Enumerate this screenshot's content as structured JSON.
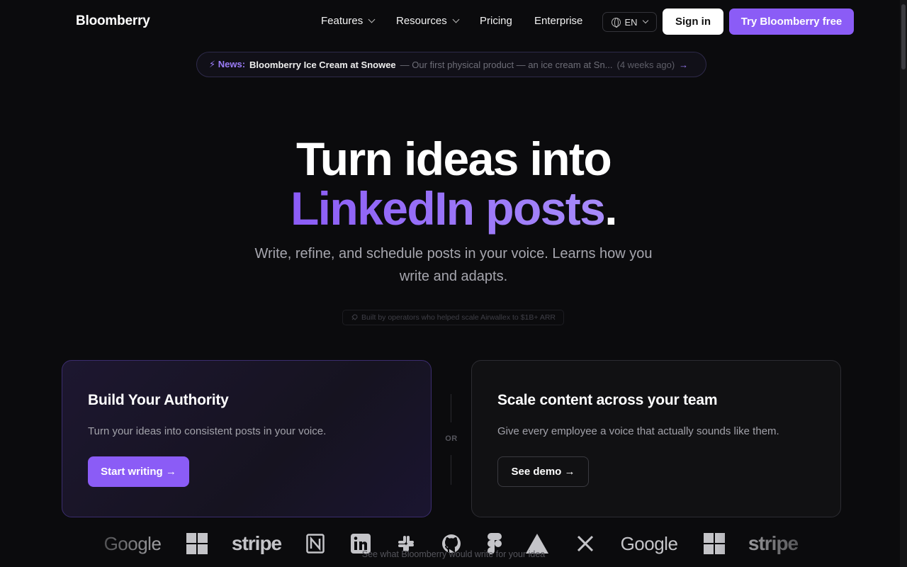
{
  "nav": {
    "logo": "Bloomberry",
    "features": "Features",
    "resources": "Resources",
    "pricing": "Pricing",
    "enterprise": "Enterprise",
    "language": "EN",
    "sign_in": "Sign in",
    "try_free": "Try Bloomberry free"
  },
  "news": {
    "tag": "⚡ News:",
    "title": "Bloomberry Ice Cream at Snowee",
    "description": "— Our first physical product — an ice cream at Sn...",
    "time": "(4 weeks ago)",
    "arrow": "→"
  },
  "hero": {
    "line1": "Turn ideas into",
    "highlight": "LinkedIn posts",
    "period": ".",
    "subtitle": "Write, refine, and schedule posts in your voice. Learns how you write and adapts.",
    "built_by": "Built by operators who helped scale Airwallex to $1B+ ARR"
  },
  "cards": {
    "authority": {
      "title": "Build Your Authority",
      "description": "Turn your ideas into consistent posts in your voice.",
      "button": "Start writing →"
    },
    "or": "OR",
    "team": {
      "title": "Scale content across your team",
      "description": "Give every employee a voice that actually sounds like them.",
      "button": "See demo →"
    }
  },
  "logos": {
    "google": "Google",
    "stripe": "stripe",
    "notion": "N",
    "linkedin": "in",
    "items": [
      "google",
      "microsoft",
      "stripe",
      "notion",
      "linkedin",
      "slack",
      "github",
      "figma",
      "vercel",
      "x",
      "google",
      "microsoft",
      "stripe"
    ]
  },
  "footer_hint": "See what Bloomberry would write for your idea",
  "colors": {
    "accent": "#8b5cf6",
    "accent_light": "#a78bfa",
    "background": "#0b0b0d"
  }
}
